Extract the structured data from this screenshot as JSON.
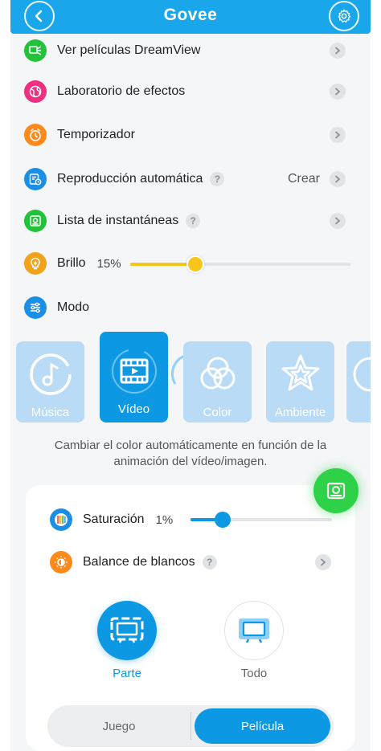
{
  "header": {
    "logo": "Govee",
    "back_icon": "chevron-left-icon",
    "settings_icon": "gear-icon"
  },
  "menu": {
    "dreamview": {
      "label": "Ver películas DreamView",
      "icon": "dreamview-icon",
      "color": "#22c33a"
    },
    "effects_lab": {
      "label": "Laboratorio de efectos",
      "icon": "globe-icon",
      "color": "#ef2f7f"
    },
    "timer": {
      "label": "Temporizador",
      "icon": "clock-icon",
      "color": "#ff8a1c"
    },
    "autoplay": {
      "label": "Reproducción automática",
      "help": "?",
      "action": "Crear",
      "icon": "schedule-icon",
      "color": "#1b8fe6"
    },
    "snapshots": {
      "label": "Lista de instantáneas",
      "help": "?",
      "icon": "snapshot-icon",
      "color": "#22c33a"
    },
    "brightness": {
      "label": "Brillo",
      "value": "15%",
      "level": 0.15,
      "icon": "bulb-icon",
      "color": "#f0a21b"
    },
    "mode": {
      "label": "Modo",
      "icon": "sliders-icon",
      "color": "#1b8fe6"
    }
  },
  "modes": [
    {
      "label": "Música",
      "icon": "music-icon",
      "active": false
    },
    {
      "label": "Vídeo",
      "icon": "video-icon",
      "active": true
    },
    {
      "label": "Color",
      "icon": "color-rings-icon",
      "active": false
    },
    {
      "label": "Ambiente",
      "icon": "star-icon",
      "active": false
    }
  ],
  "mode_description": "Cambiar el color automáticamente en función de la animación del vídeo/imagen.",
  "video_settings": {
    "saturation": {
      "label": "Saturación",
      "value": "1%",
      "level": 0.01
    },
    "white_balance": {
      "label": "Balance de blancos",
      "help": "?"
    },
    "area_options": [
      {
        "label": "Parte",
        "active": true
      },
      {
        "label": "Todo",
        "active": false
      }
    ],
    "scene": {
      "left": "Juego",
      "right": "Película",
      "selected": "Película"
    }
  },
  "colors": {
    "accent": "#0c98e3",
    "header": "#1aa6ea",
    "slider_yellow": "#f8c61b",
    "fab_green": "#2ed248"
  }
}
